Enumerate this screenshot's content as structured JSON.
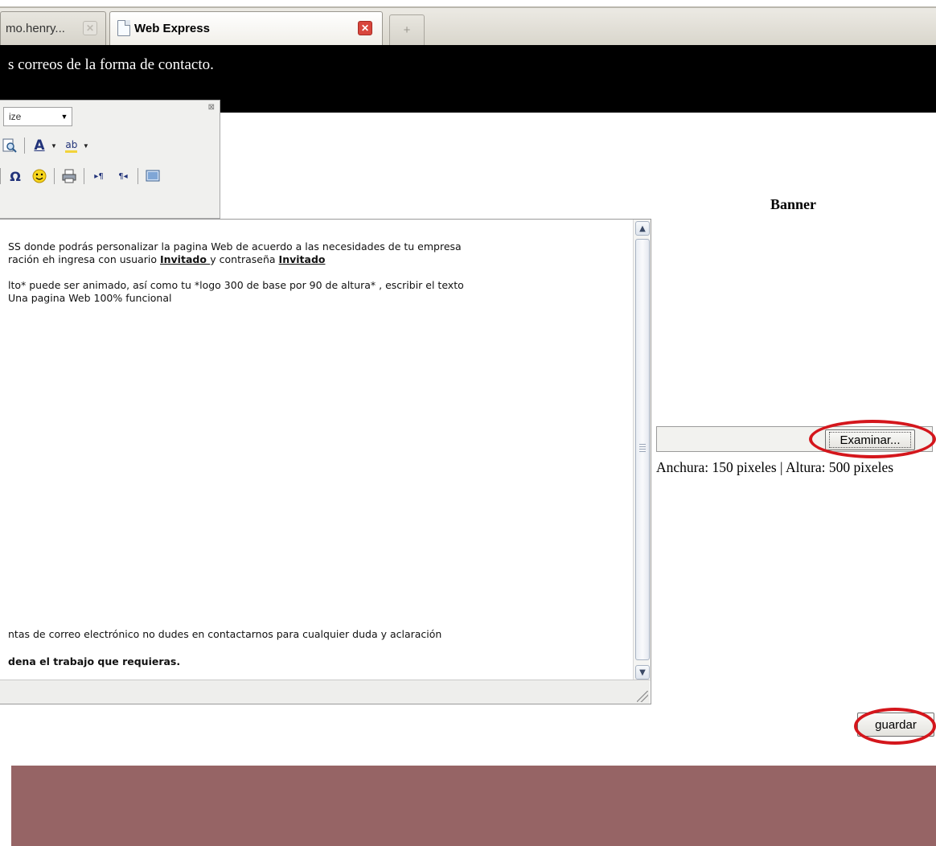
{
  "browser": {
    "tabs": [
      {
        "label": "mo.henry...",
        "active": false
      },
      {
        "label": "Web Express",
        "active": true
      }
    ],
    "tab_close_glyph": "✕",
    "new_tab_glyph": "+"
  },
  "header": {
    "text": "s correos de la forma de contacto."
  },
  "toolbar": {
    "size_select_value": "ize",
    "close_glyph": "⊠",
    "row1_icons": [
      "find-replace-icon",
      "font-color-icon",
      "highlight-color-icon"
    ],
    "row2_icons": [
      "special-char-icon",
      "smiley-icon",
      "print-icon",
      "ltr-icon",
      "rtl-icon",
      "fullscreen-icon"
    ],
    "glyphs": {
      "omega": "Ω",
      "smiley": "☺",
      "font_color": "A",
      "highlight": "ab",
      "ltr": "▸¶",
      "rtl": "¶◂"
    }
  },
  "editor": {
    "line1": "SS donde podrás personalizar la pagina Web de acuerdo a las necesidades de tu empresa",
    "line2_prefix": "ración eh ingresa con usuario ",
    "line2_user": "Invitado ",
    "line2_mid": "y contraseña ",
    "line2_pass": "Invitado ",
    "line3": "lto*  puede ser animado,  así como tu *logo 300 de base por 90 de altura* ,   escribir el texto",
    "line4": " Una pagina Web 100% funcional",
    "line5": "ntas de correo electrónico no dudes en contactarnos para cualquier duda y aclaración",
    "line6": "dena el trabajo que requieras."
  },
  "banner": {
    "title": "Banner",
    "browse_label": "Examinar...",
    "size_hint": "Anchura: 150 pixeles | Altura: 500 pixeles"
  },
  "actions": {
    "save_label": "guardar"
  },
  "colors": {
    "header_bg": "#000000",
    "footer_bg": "#966465",
    "highlight_oval": "#d4161c"
  }
}
